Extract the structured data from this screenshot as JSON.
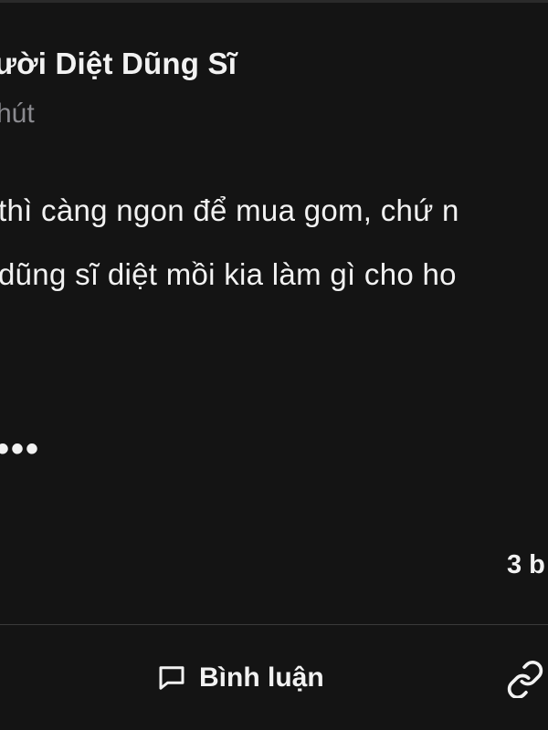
{
  "post": {
    "author_name": "ười Diệt Dũng Sĩ",
    "time_ago": "hút",
    "body_lines": [
      "thì càng ngon để mua gom, chứ n",
      "dũng sĩ diệt mồi kia làm gì cho ho"
    ],
    "more_label": "•••",
    "stats_text": "3 b"
  },
  "actions": {
    "comment_label": "Bình luận",
    "comment_icon": "speech-bubble-icon",
    "share_icon": "link-icon"
  }
}
